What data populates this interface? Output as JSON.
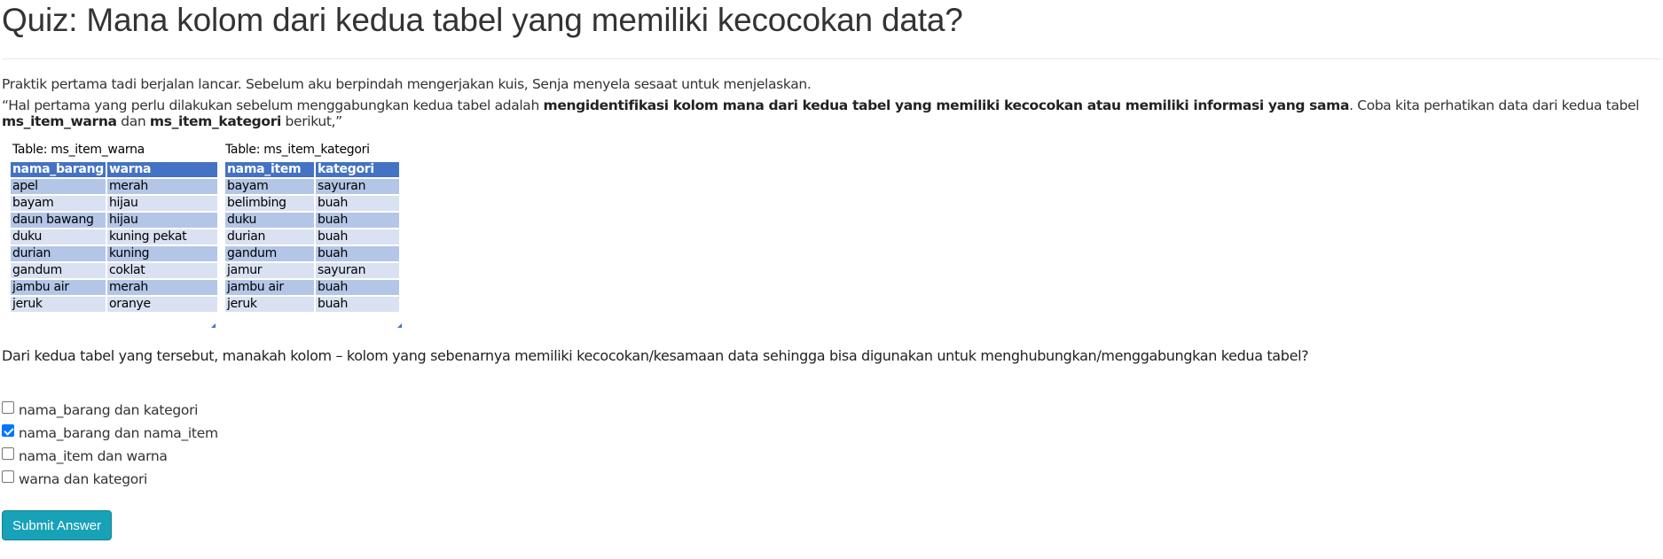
{
  "title": "Quiz: Mana kolom dari kedua tabel yang memiliki kecocokan data?",
  "intro": "Praktik pertama tadi berjalan lancar. Sebelum aku berpindah mengerjakan kuis, Senja menyela sesaat untuk menjelaskan.",
  "quote": {
    "part1": "“Hal pertama yang perlu dilakukan sebelum menggabungkan kedua tabel adalah ",
    "bold1": "mengidentifikasi kolom mana dari kedua tabel yang memiliki kecocokan atau memiliki informasi yang sama",
    "part2": ". Coba  kita perhatikan data dari kedua tabel ",
    "bold2": "ms_item_warna",
    "part3": " dan ",
    "bold3": "ms_item_kategori",
    "part4": " berikut,”"
  },
  "table1": {
    "caption": "Table: ms_item_warna",
    "headers": [
      "nama_barang",
      "warna"
    ],
    "rows": [
      [
        "apel",
        "merah"
      ],
      [
        "bayam",
        "hijau"
      ],
      [
        "daun bawang",
        "hijau"
      ],
      [
        "duku",
        "kuning pekat"
      ],
      [
        "durian",
        "kuning"
      ],
      [
        "gandum",
        "coklat"
      ],
      [
        "jambu air",
        "merah"
      ],
      [
        "jeruk",
        "oranye"
      ]
    ]
  },
  "table2": {
    "caption": "Table: ms_item_kategori",
    "headers": [
      "nama_item",
      "kategori"
    ],
    "rows": [
      [
        "bayam",
        "sayuran"
      ],
      [
        "belimbing",
        "buah"
      ],
      [
        "duku",
        "buah"
      ],
      [
        "durian",
        "buah"
      ],
      [
        "gandum",
        "buah"
      ],
      [
        "jamur",
        "sayuran"
      ],
      [
        "jambu air",
        "buah"
      ],
      [
        "jeruk",
        "buah"
      ]
    ]
  },
  "question": "Dari kedua tabel yang tersebut, manakah kolom – kolom yang sebenarnya memiliki kecocokan/kesamaan data sehingga bisa digunakan untuk menghubungkan/menggabungkan kedua tabel?",
  "options": [
    {
      "label": "nama_barang dan kategori",
      "checked": false
    },
    {
      "label": "nama_barang dan nama_item",
      "checked": true
    },
    {
      "label": "nama_item dan warna",
      "checked": false
    },
    {
      "label": "warna dan kategori",
      "checked": false
    }
  ],
  "submit_label": "Submit Answer",
  "colors": {
    "table_header": "#4472c4",
    "row_band_dark": "#b4c6e7",
    "row_band_light": "#d9e1f2",
    "button": "#17a2b8",
    "checkbox_checked": "#0075ff"
  }
}
